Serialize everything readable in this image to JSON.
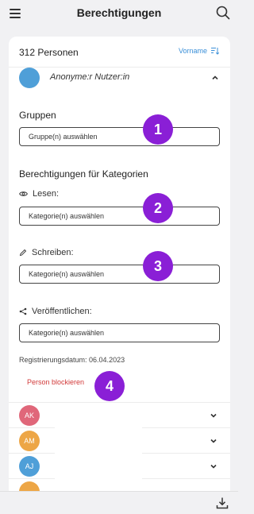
{
  "header": {
    "title": "Berechtigungen",
    "menu_icon": "hamburger-menu-icon",
    "search_icon": "search-icon"
  },
  "list": {
    "count": "312 Personen",
    "sort_label": "Vorname",
    "sort_icon": "sort-descending-icon"
  },
  "person": {
    "name": "Anonyme:r Nutzer:in",
    "avatar_color": "#4f9fd8",
    "groups_title": "Gruppen",
    "groups_placeholder": "Gruppe(n) auswählen",
    "categories_title": "Berechtigungen für Kategorien",
    "read_label": "Lesen:",
    "read_placeholder": "Kategorie(n) auswählen",
    "write_label": "Schreiben:",
    "write_placeholder": "Kategorie(n) auswählen",
    "publish_label": "Veröffentlichen:",
    "publish_placeholder": "Kategorie(n) auswählen",
    "registration_date": "Registrierungsdatum: 06.04.2023",
    "block_label": "Person blockieren"
  },
  "badges": [
    "1",
    "2",
    "3",
    "4"
  ],
  "other_persons": [
    {
      "initials": "AK",
      "color": "#e0677a"
    },
    {
      "initials": "AM",
      "color": "#eda646"
    },
    {
      "initials": "AJ",
      "color": "#4f9fd8"
    },
    {
      "initials": "",
      "color": "#eda646"
    }
  ],
  "colors": {
    "accent": "#3a8fd8",
    "badge": "#8a1fd6",
    "danger": "#d23a3a"
  },
  "footer": {
    "download_icon": "download-icon"
  }
}
